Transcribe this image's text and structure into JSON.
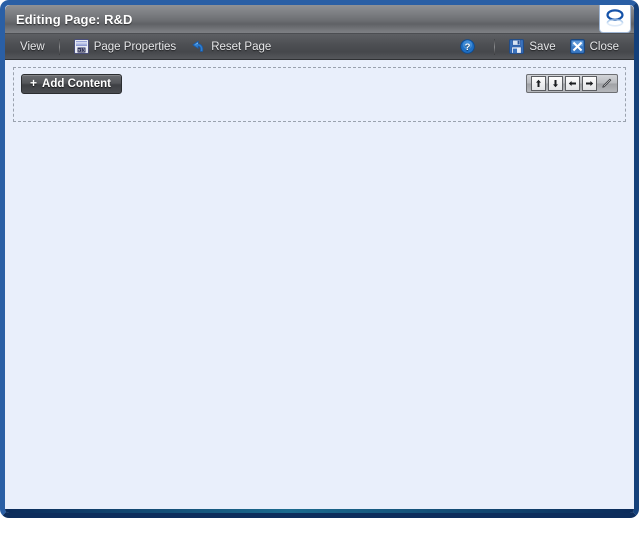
{
  "window": {
    "title": "Editing Page: R&D",
    "brand_logo_icon": "oval-logo-icon",
    "border_color": "#1b3f77",
    "canvas_color": "#e9effb"
  },
  "toolbar": {
    "left_items": [
      {
        "label": "View",
        "icon": "",
        "name": "view"
      },
      {
        "label": "Page Properties",
        "icon": "page-properties-icon",
        "name": "page-properties"
      },
      {
        "label": "Reset Page",
        "icon": "reset-page-icon",
        "name": "reset-page"
      }
    ],
    "right_items": [
      {
        "label": "",
        "icon": "help-icon",
        "name": "help"
      },
      {
        "label": "Save",
        "icon": "save-icon",
        "name": "save"
      },
      {
        "label": "Close",
        "icon": "close-icon",
        "name": "close"
      }
    ],
    "help_label": "",
    "save_label": "Save",
    "close_label": "Close",
    "view_label": "View",
    "page_properties_label": "Page Properties",
    "reset_page_label": "Reset Page",
    "accent_color": "#1f6fc4"
  },
  "region": {
    "add_content_label": "Add Content",
    "add_content_plus": "+",
    "tools": [
      {
        "name": "move-up",
        "icon": "arrow-up-icon",
        "tip": "Move Up"
      },
      {
        "name": "move-down",
        "icon": "arrow-down-icon",
        "tip": "Move Down"
      },
      {
        "name": "move-left",
        "icon": "arrow-left-icon",
        "tip": "Move Left"
      },
      {
        "name": "move-right",
        "icon": "arrow-right-icon",
        "tip": "Move Right"
      },
      {
        "name": "edit",
        "icon": "pencil-icon",
        "tip": "Edit"
      }
    ],
    "border_style": "dashed",
    "border_color": "#9aa2ae"
  },
  "canvas": {
    "content": ""
  }
}
